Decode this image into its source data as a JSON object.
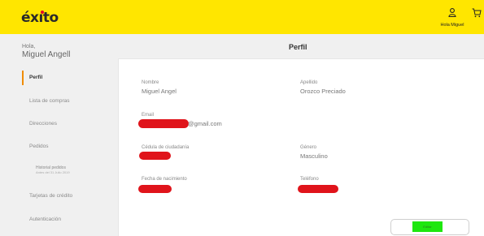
{
  "header": {
    "logo": "éxito",
    "user_label": "Hola Miguel"
  },
  "sidebar": {
    "greeting_small": "Hola,",
    "greeting_name": "Miguel Angell",
    "items": [
      {
        "label": "Perfil"
      },
      {
        "label": "Lista de compras"
      },
      {
        "label": "Direcciones"
      },
      {
        "label": "Pedidos"
      },
      {
        "label": "Historial pedidos",
        "sub": "Antes del 31 Julio 2019"
      },
      {
        "label": "Tarjetas de crédito"
      },
      {
        "label": "Autenticación"
      }
    ]
  },
  "profile": {
    "title": "Perfil",
    "fields": {
      "nombre": {
        "label": "Nombre",
        "value": "Miguel Angel"
      },
      "apellido": {
        "label": "Apellido",
        "value": "Orozco Preciado"
      },
      "email": {
        "label": "Email",
        "value": "@gmail.com"
      },
      "cedula": {
        "label": "Cédula de ciudadanía"
      },
      "genero": {
        "label": "Género",
        "value": "Masculino"
      },
      "fecha": {
        "label": "Fecha de nacimiento"
      },
      "telefono": {
        "label": "Teléfono"
      }
    },
    "save_label": "Editar"
  },
  "colors": {
    "header_bg": "#ffe600",
    "active_accent": "#f08c00",
    "redaction": "#e0141b",
    "button_fill": "#1ee70f"
  }
}
